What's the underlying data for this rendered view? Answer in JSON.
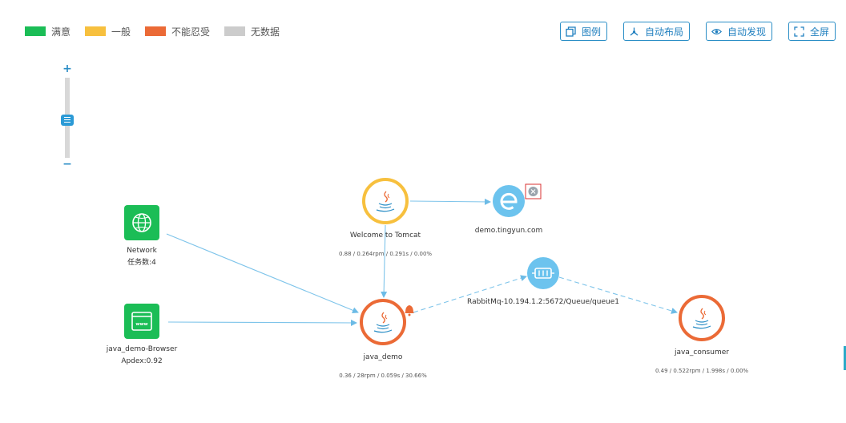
{
  "legend": {
    "items": [
      {
        "label": "满意",
        "color": "#1bbd56"
      },
      {
        "label": "一般",
        "color": "#f7c03e"
      },
      {
        "label": "不能忍受",
        "color": "#eb6a36"
      },
      {
        "label": "无数据",
        "color": "#cccccc"
      }
    ]
  },
  "toolbar": {
    "legend_label": "图例",
    "auto_layout_label": "自动布局",
    "auto_discover_label": "自动发现",
    "fullscreen_label": "全屏"
  },
  "zoom": {
    "plus": "+",
    "minus": "−",
    "level": 0.5
  },
  "nodes": {
    "network": {
      "label": "Network",
      "sub": "任务数:4",
      "icon": "globe-icon"
    },
    "browser": {
      "label": "java_demo-Browser",
      "sub": "Apdex:0.92",
      "icon": "browser-www-icon"
    },
    "tomcat": {
      "label": "Welcome to Tomcat",
      "metrics": "0.88 / 0.264rpm / 0.291s / 0.00%",
      "icon": "java-icon",
      "status_color": "#f7c03e"
    },
    "tingyun": {
      "label": "demo.tingyun.com",
      "icon": "external-service-e-icon"
    },
    "rabbitmq": {
      "label": "RabbitMq-10.194.1.2:5672/Queue/queue1",
      "icon": "message-queue-icon"
    },
    "java_demo": {
      "label": "java_demo",
      "metrics": "0.36 / 28rpm / 0.059s / 30.66%",
      "icon": "java-icon",
      "status_color": "#eb6a36"
    },
    "java_consumer": {
      "label": "java_consumer",
      "metrics": "0.49 / 0.522rpm / 1.998s / 0.00%",
      "icon": "java-icon",
      "status_color": "#eb6a36"
    }
  },
  "colors": {
    "accent": "#2b8ec6",
    "edge": "#7ec4ea",
    "node_blue": "#6cc3ee",
    "node_green": "#1bbd56"
  }
}
